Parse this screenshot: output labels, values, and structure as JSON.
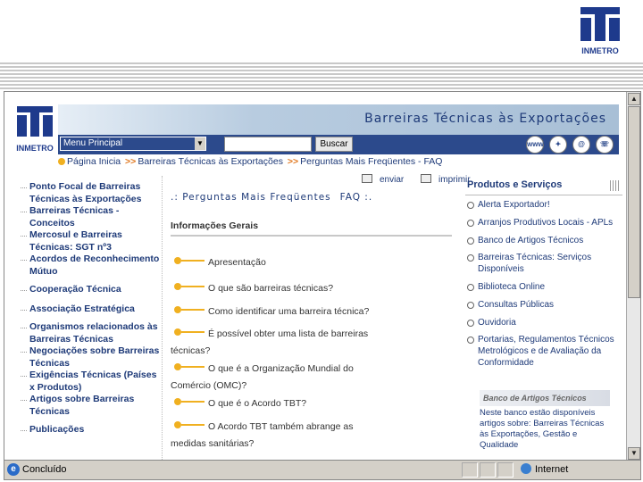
{
  "slide": {
    "logo_text": "INMETRO"
  },
  "status": {
    "left_text": "Concluído",
    "zone_text": "Internet"
  },
  "site": {
    "logo_text": "INMETRO",
    "banner_title": "Barreiras Técnicas às Exportações",
    "menu_label": "Menu Principal",
    "search_value": "",
    "search_button": "Buscar",
    "nav_icons": [
      "www-icon",
      "compass-icon",
      "at-icon",
      "phone-icon"
    ]
  },
  "breadcrumb": {
    "items": [
      "Página Inicia",
      "Barreiras Técnicas às Exportações",
      "Perguntas Mais Freqüentes - FAQ"
    ]
  },
  "tools": {
    "send": "enviar",
    "print": "imprimir"
  },
  "leftnav": [
    "Ponto Focal de Barreiras Técnicas às Exportações",
    "Barreiras Técnicas - Conceitos",
    "Mercosul e Barreiras Técnicas: SGT nº3",
    "Acordos de Reconhecimento Mútuo",
    "Cooperação Técnica",
    "Associação Estratégica",
    "Organismos relacionados às Barreiras Técnicas",
    "Negociações sobre Barreiras Técnicas",
    "Exigências Técnicas (Países x Produtos)",
    "Artigos sobre Barreiras Técnicas",
    "Publicações"
  ],
  "center": {
    "heading": ".: Perguntas Mais Freqüentes",
    "heading2": "FAQ :.",
    "section": "Informações Gerais",
    "questions": [
      "Apresentação",
      "O que são barreiras técnicas?",
      "Como identificar uma barreira técnica?",
      "É possível obter uma lista de barreiras técnicas?",
      "O que é a Organização Mundial do Comércio (OMC)?",
      "O que é o Acordo TBT?",
      "O Acordo TBT também abrange as medidas sanitárias?"
    ]
  },
  "right": {
    "heading": "Produtos e Serviços",
    "items": [
      "Alerta Exportador!",
      "Arranjos Produtivos Locais - APLs",
      "Banco de Artigos Técnicos",
      "Barreiras Técnicas: Serviços Disponíveis",
      "Biblioteca Online",
      "Consultas Públicas",
      "Ouvidoria",
      "Portarias, Regulamentos Técnicos Metrológicos e de Avaliação da Conformidade"
    ],
    "bank_title": "Banco de Artigos Técnicos",
    "bank_text": "Neste banco estão disponíveis artigos sobre: Barreiras Técnicas às Exportações, Gestão e Qualidade"
  }
}
